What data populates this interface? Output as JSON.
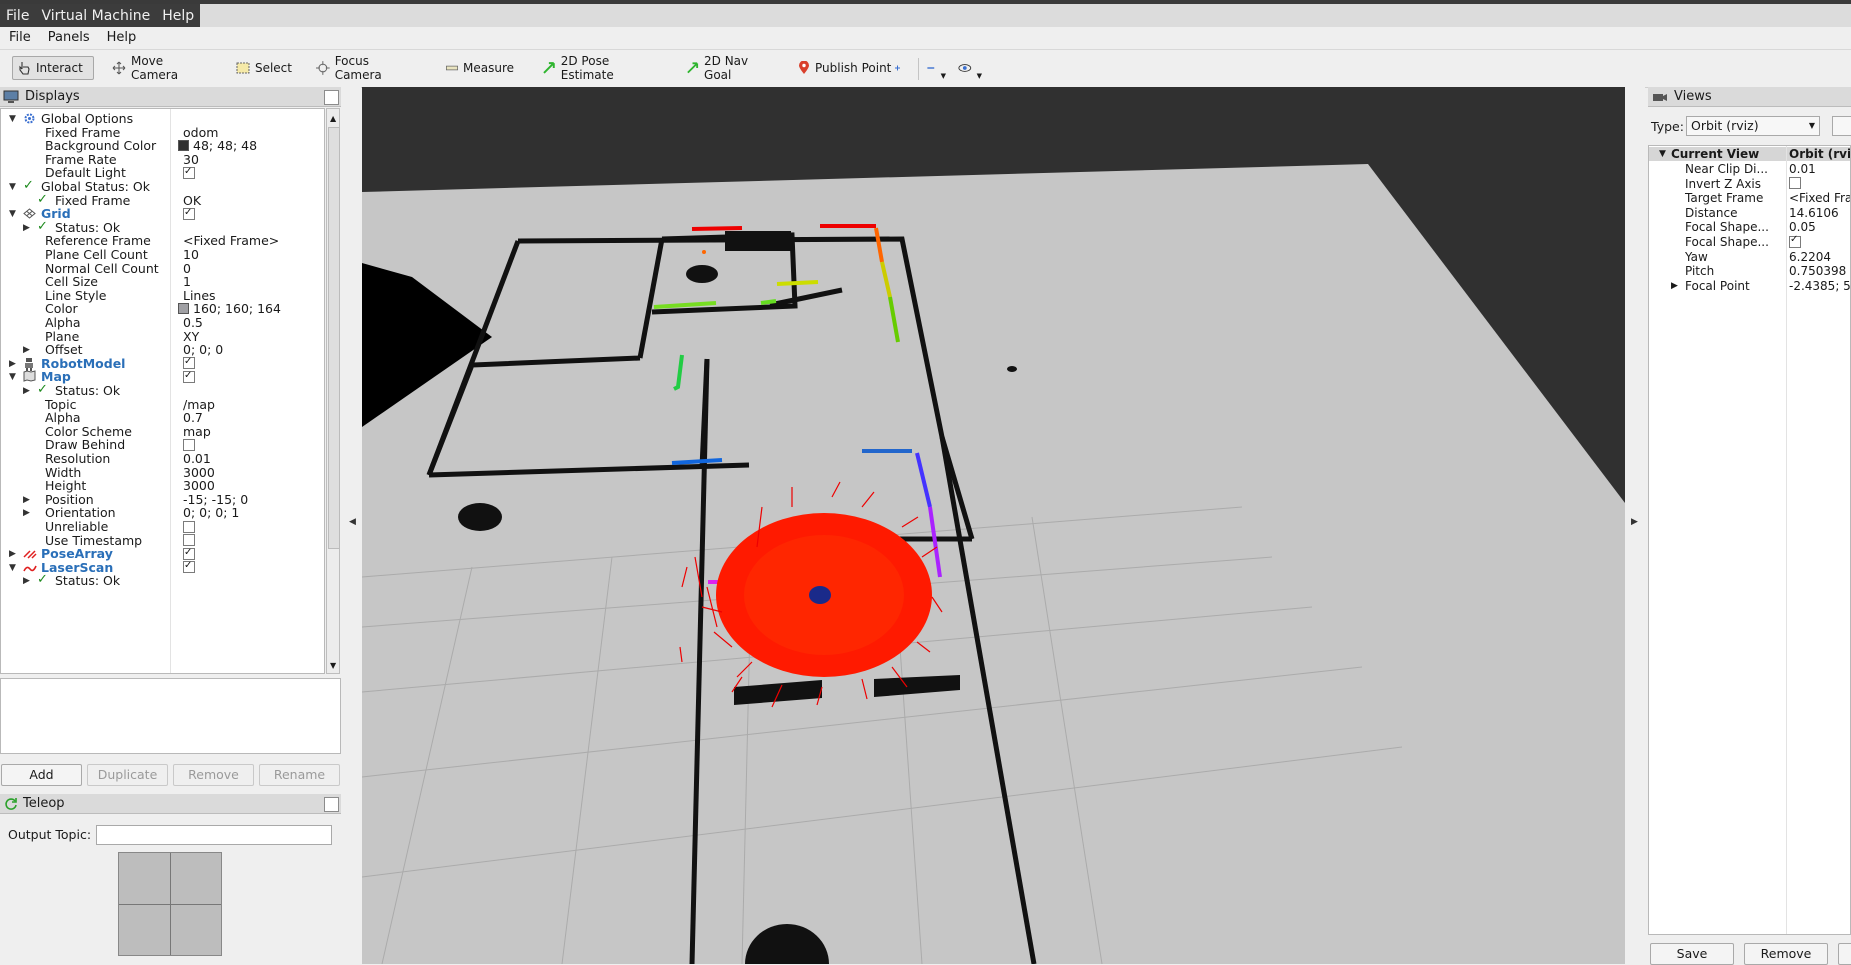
{
  "vm_menu": [
    "File",
    "Virtual Machine",
    "Help"
  ],
  "app_menu": [
    "File",
    "Panels",
    "Help"
  ],
  "toolbar": {
    "interact": "Interact",
    "move_camera": "Move Camera",
    "select": "Select",
    "focus_camera": "Focus Camera",
    "measure": "Measure",
    "pose_estimate": "2D Pose Estimate",
    "nav_goal": "2D Nav Goal",
    "publish_point": "Publish Point"
  },
  "displays": {
    "title": "Displays",
    "rows": [
      {
        "name": "Global Options",
        "value": ""
      },
      {
        "name": "Fixed Frame",
        "value": "odom"
      },
      {
        "name": "Background Color",
        "value": "48; 48; 48"
      },
      {
        "name": "Frame Rate",
        "value": "30"
      },
      {
        "name": "Default Light",
        "value": ""
      },
      {
        "name": "Global Status: Ok",
        "value": ""
      },
      {
        "name": "Fixed Frame",
        "value": "OK"
      },
      {
        "name": "Grid",
        "value": ""
      },
      {
        "name": "Status: Ok",
        "value": ""
      },
      {
        "name": "Reference Frame",
        "value": "<Fixed Frame>"
      },
      {
        "name": "Plane Cell Count",
        "value": "10"
      },
      {
        "name": "Normal Cell Count",
        "value": "0"
      },
      {
        "name": "Cell Size",
        "value": "1"
      },
      {
        "name": "Line Style",
        "value": "Lines"
      },
      {
        "name": "Color",
        "value": "160; 160; 164"
      },
      {
        "name": "Alpha",
        "value": "0.5"
      },
      {
        "name": "Plane",
        "value": "XY"
      },
      {
        "name": "Offset",
        "value": "0; 0; 0"
      },
      {
        "name": "RobotModel",
        "value": ""
      },
      {
        "name": "Map",
        "value": ""
      },
      {
        "name": "Status: Ok",
        "value": ""
      },
      {
        "name": "Topic",
        "value": "/map"
      },
      {
        "name": "Alpha",
        "value": "0.7"
      },
      {
        "name": "Color Scheme",
        "value": "map"
      },
      {
        "name": "Draw Behind",
        "value": ""
      },
      {
        "name": "Resolution",
        "value": "0.01"
      },
      {
        "name": "Width",
        "value": "3000"
      },
      {
        "name": "Height",
        "value": "3000"
      },
      {
        "name": "Position",
        "value": "-15; -15; 0"
      },
      {
        "name": "Orientation",
        "value": "0; 0; 0; 1"
      },
      {
        "name": "Unreliable",
        "value": ""
      },
      {
        "name": "Use Timestamp",
        "value": ""
      },
      {
        "name": "PoseArray",
        "value": ""
      },
      {
        "name": "LaserScan",
        "value": ""
      },
      {
        "name": "Status: Ok",
        "value": ""
      }
    ],
    "add": "Add",
    "duplicate": "Duplicate",
    "remove": "Remove",
    "rename": "Rename"
  },
  "teleop": {
    "title": "Teleop",
    "output_topic_label": "Output Topic:",
    "output_topic_value": ""
  },
  "views": {
    "title": "Views",
    "type_label": "Type:",
    "type_value": "Orbit (rviz)",
    "header_name": "Current View",
    "header_value": "Orbit (rviz)",
    "rows": [
      {
        "name": "Near Clip Di...",
        "value": "0.01"
      },
      {
        "name": "Invert Z Axis",
        "value": ""
      },
      {
        "name": "Target Frame",
        "value": "<Fixed Fra"
      },
      {
        "name": "Distance",
        "value": "14.6106"
      },
      {
        "name": "Focal Shape...",
        "value": "0.05"
      },
      {
        "name": "Focal Shape...",
        "value": ""
      },
      {
        "name": "Yaw",
        "value": "6.2204"
      },
      {
        "name": "Pitch",
        "value": "0.750398"
      },
      {
        "name": "Focal Point",
        "value": "-2.4385; 5."
      }
    ],
    "save": "Save",
    "remove": "Remove"
  }
}
